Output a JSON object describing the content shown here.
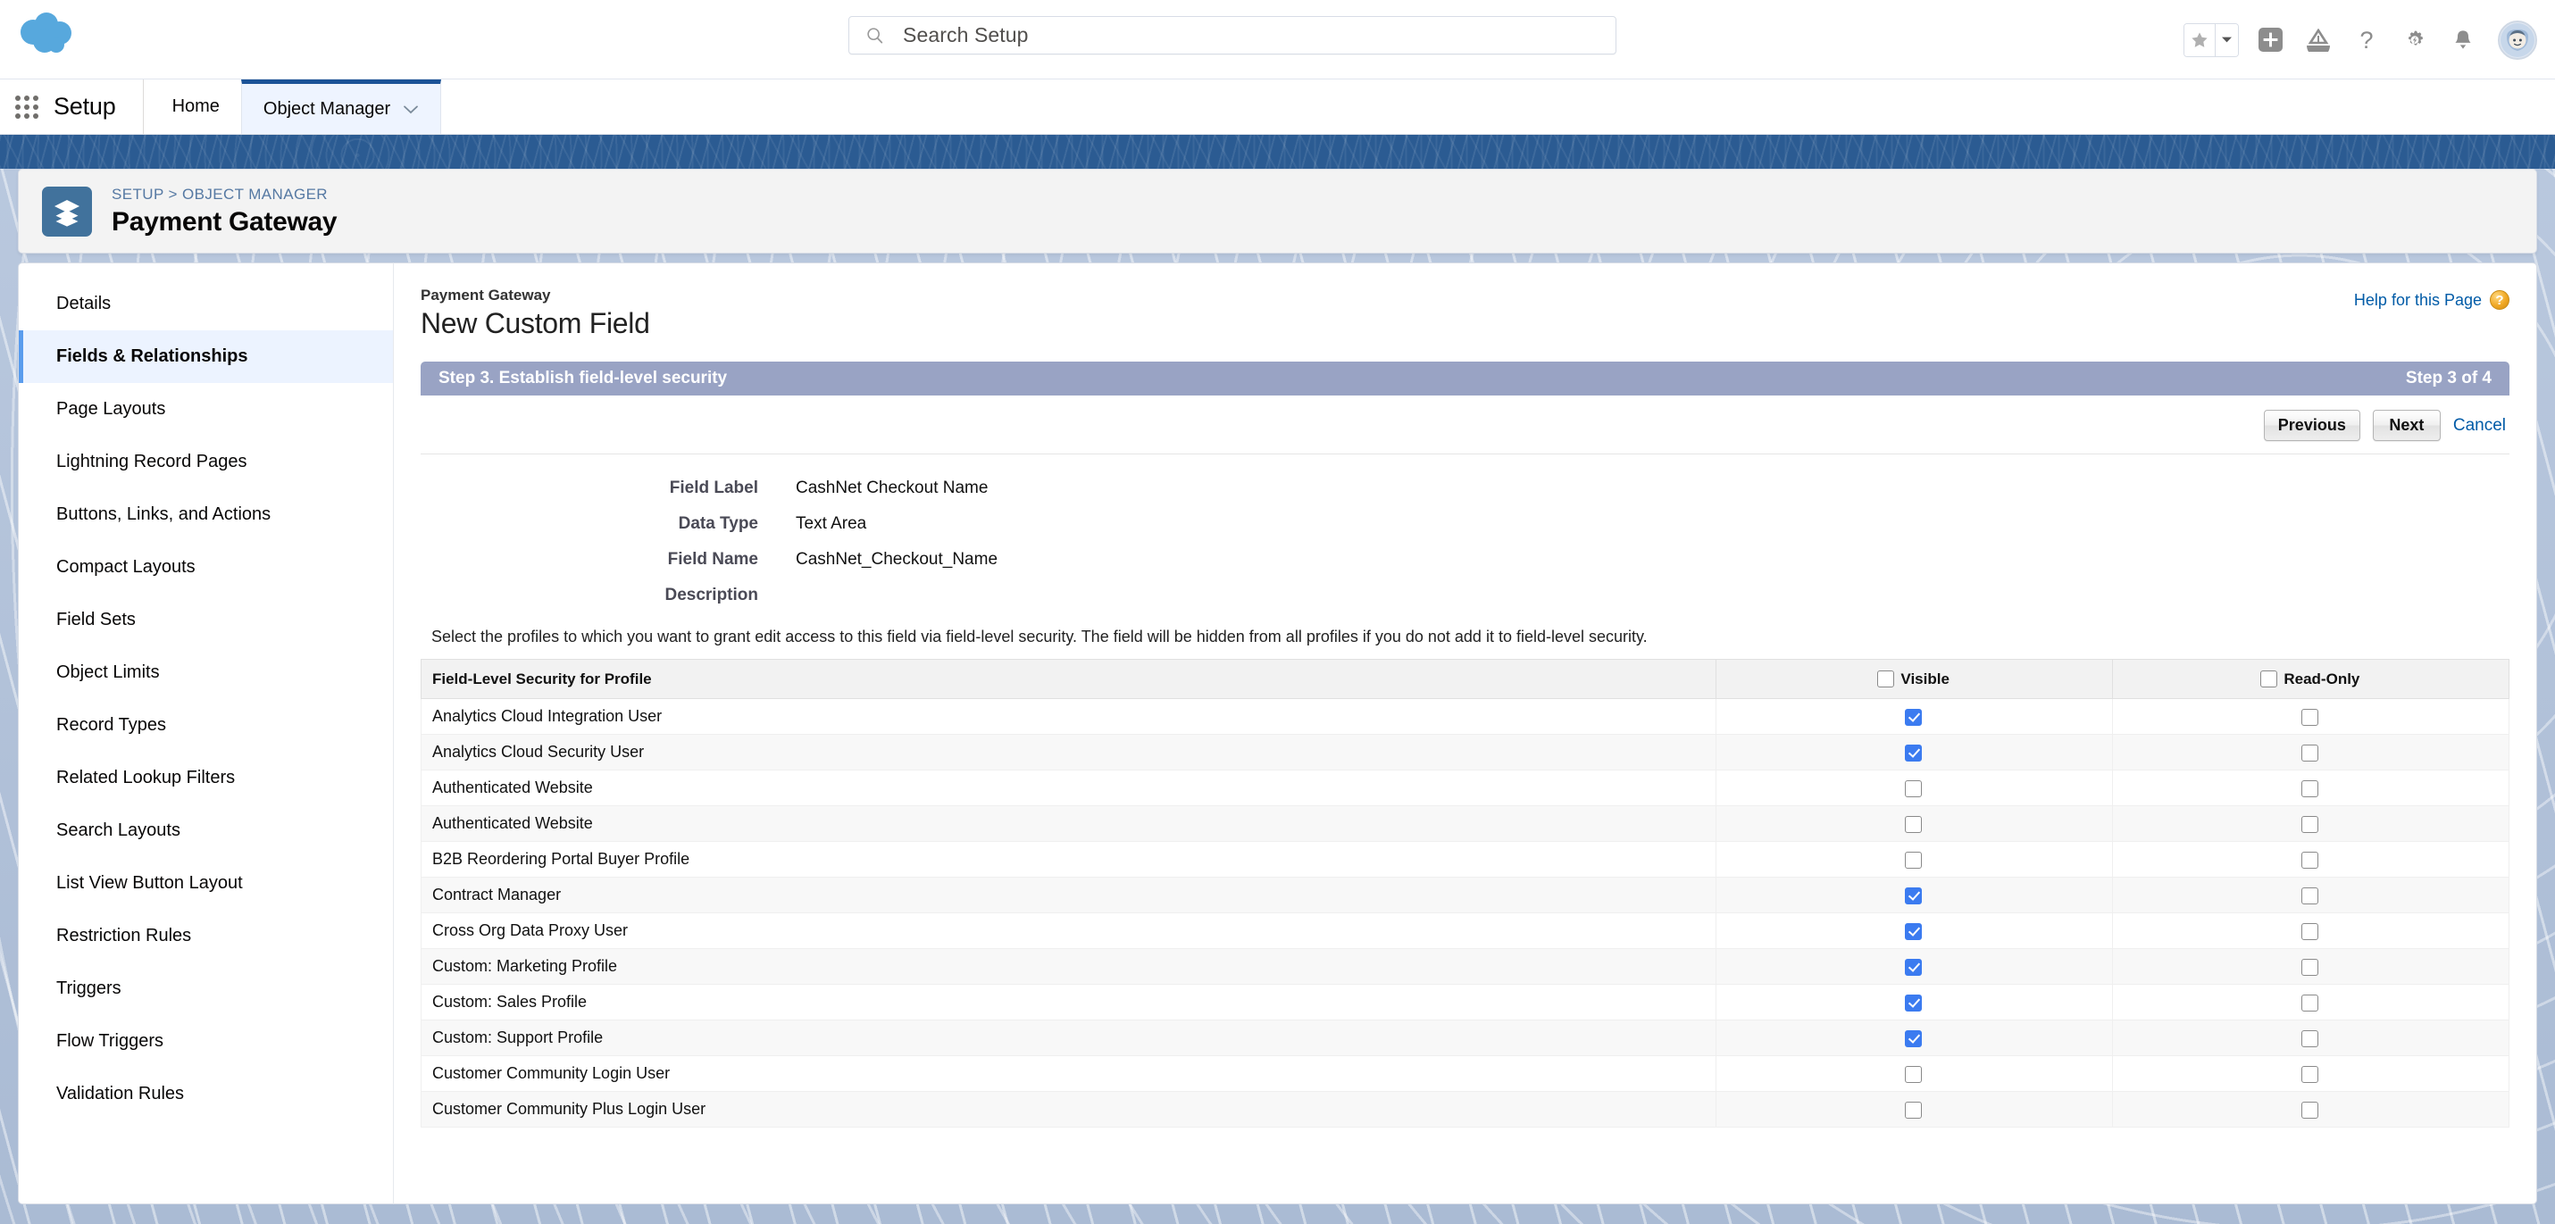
{
  "header": {
    "logo_icon": "salesforce-cloud-logo",
    "search": {
      "placeholder": "Search Setup",
      "value": "",
      "icon": "search-icon"
    },
    "actions": [
      {
        "name": "favorites-star",
        "icon": "star-icon"
      },
      {
        "name": "favorites-dropdown",
        "icon": "chevron-down-icon"
      },
      {
        "name": "global-create",
        "icon": "plus-icon"
      },
      {
        "name": "trailhead",
        "icon": "mountain-icon"
      },
      {
        "name": "help",
        "icon": "question-mark-icon"
      },
      {
        "name": "setup-gear",
        "icon": "gear-icon"
      },
      {
        "name": "notifications",
        "icon": "bell-icon"
      },
      {
        "name": "user-profile",
        "icon": "avatar-icon"
      }
    ]
  },
  "setup_nav": {
    "app_launcher_icon": "app-launcher-waffle-icon",
    "title": "Setup",
    "tabs": [
      {
        "label": "Home",
        "active": false,
        "has_caret": false
      },
      {
        "label": "Object Manager",
        "active": true,
        "has_caret": true
      }
    ]
  },
  "record_header": {
    "icon": "layers-stack-icon",
    "breadcrumb": [
      "SETUP",
      "OBJECT MANAGER"
    ],
    "breadcrumb_separator": ">",
    "title": "Payment Gateway"
  },
  "sidebar": {
    "items": [
      {
        "label": "Details",
        "active": false
      },
      {
        "label": "Fields & Relationships",
        "active": true
      },
      {
        "label": "Page Layouts",
        "active": false
      },
      {
        "label": "Lightning Record Pages",
        "active": false
      },
      {
        "label": "Buttons, Links, and Actions",
        "active": false
      },
      {
        "label": "Compact Layouts",
        "active": false
      },
      {
        "label": "Field Sets",
        "active": false
      },
      {
        "label": "Object Limits",
        "active": false
      },
      {
        "label": "Record Types",
        "active": false
      },
      {
        "label": "Related Lookup Filters",
        "active": false
      },
      {
        "label": "Search Layouts",
        "active": false
      },
      {
        "label": "List View Button Layout",
        "active": false
      },
      {
        "label": "Restriction Rules",
        "active": false
      },
      {
        "label": "Triggers",
        "active": false
      },
      {
        "label": "Flow Triggers",
        "active": false
      },
      {
        "label": "Validation Rules",
        "active": false
      }
    ]
  },
  "main": {
    "object_label": "Payment Gateway",
    "page_title": "New Custom Field",
    "help_link": "Help for this Page",
    "help_icon": "help-question-badge-icon",
    "step_bar": {
      "title": "Step 3. Establish field-level security",
      "counter": "Step 3 of 4"
    },
    "buttons": {
      "previous": "Previous",
      "next": "Next",
      "cancel": "Cancel"
    },
    "field_summary": [
      {
        "label": "Field Label",
        "value": "CashNet Checkout Name"
      },
      {
        "label": "Data Type",
        "value": "Text Area"
      },
      {
        "label": "Field Name",
        "value": "CashNet_Checkout_Name"
      },
      {
        "label": "Description",
        "value": ""
      }
    ],
    "instructions": "Select the profiles to which you want to grant edit access to this field via field-level security. The field will be hidden from all profiles if you do not add it to field-level security.",
    "table": {
      "columns": [
        "Field-Level Security for Profile",
        "Visible",
        "Read-Only"
      ],
      "select_all": {
        "visible": false,
        "read_only": false
      },
      "rows": [
        {
          "profile": "Analytics Cloud Integration User",
          "visible": true,
          "read_only": false
        },
        {
          "profile": "Analytics Cloud Security User",
          "visible": true,
          "read_only": false
        },
        {
          "profile": "Authenticated Website",
          "visible": false,
          "read_only": false
        },
        {
          "profile": "Authenticated Website",
          "visible": false,
          "read_only": false
        },
        {
          "profile": "B2B Reordering Portal Buyer Profile",
          "visible": false,
          "read_only": false
        },
        {
          "profile": "Contract Manager",
          "visible": true,
          "read_only": false
        },
        {
          "profile": "Cross Org Data Proxy User",
          "visible": true,
          "read_only": false
        },
        {
          "profile": "Custom: Marketing Profile",
          "visible": true,
          "read_only": false
        },
        {
          "profile": "Custom: Sales Profile",
          "visible": true,
          "read_only": false
        },
        {
          "profile": "Custom: Support Profile",
          "visible": true,
          "read_only": false
        },
        {
          "profile": "Customer Community Login User",
          "visible": false,
          "read_only": false
        },
        {
          "profile": "Customer Community Plus Login User",
          "visible": false,
          "read_only": false
        }
      ]
    }
  },
  "colors": {
    "brand_blue": "#1b5297",
    "banner_blue": "#2b5b92",
    "step_bar": "#99a3c4",
    "link_blue": "#015ba7",
    "checkbox_checked": "#3b7bf0",
    "active_nav_bg": "#ecf3ff"
  }
}
